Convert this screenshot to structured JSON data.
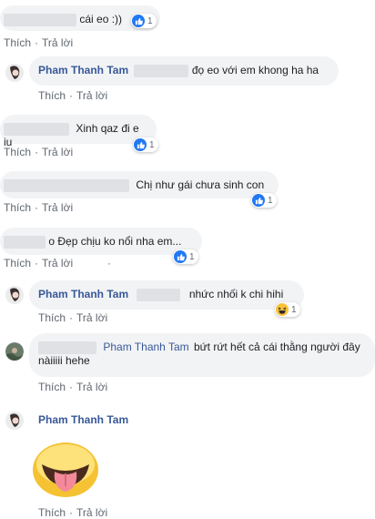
{
  "labels": {
    "like": "Thích",
    "reply": "Trả lời",
    "separator": "·"
  },
  "comments": [
    {
      "text": "cái eo :))",
      "reaction_count": "1"
    },
    {
      "author": "Pham Thanh Tam",
      "text": "đọ eo với em khong ha ha"
    },
    {
      "text": "Xinh qaz đi e iu",
      "reaction_count": "1"
    },
    {
      "text": "Chị như gái chưa sinh con",
      "reaction_count": "1"
    },
    {
      "text": "o Đẹp chịu ko nổi nha em...",
      "reaction_count": "1",
      "trailing_mark": "·"
    },
    {
      "author": "Pham Thanh Tam",
      "text": "nhức nhối k chi hihi",
      "reaction_count": "1"
    },
    {
      "tag": "Pham Thanh Tam",
      "text_line1": "bứt rứt hết cả cái thằng người đây",
      "text_line2": "nàiiiii hehe"
    },
    {
      "author": "Pham Thanh Tam",
      "sticker": "tongue-out-emoji-sticker"
    }
  ],
  "colors": {
    "bubble": "#f2f3f5",
    "name": "#385898",
    "like_blue": "#2078f4",
    "meta": "#606770"
  }
}
